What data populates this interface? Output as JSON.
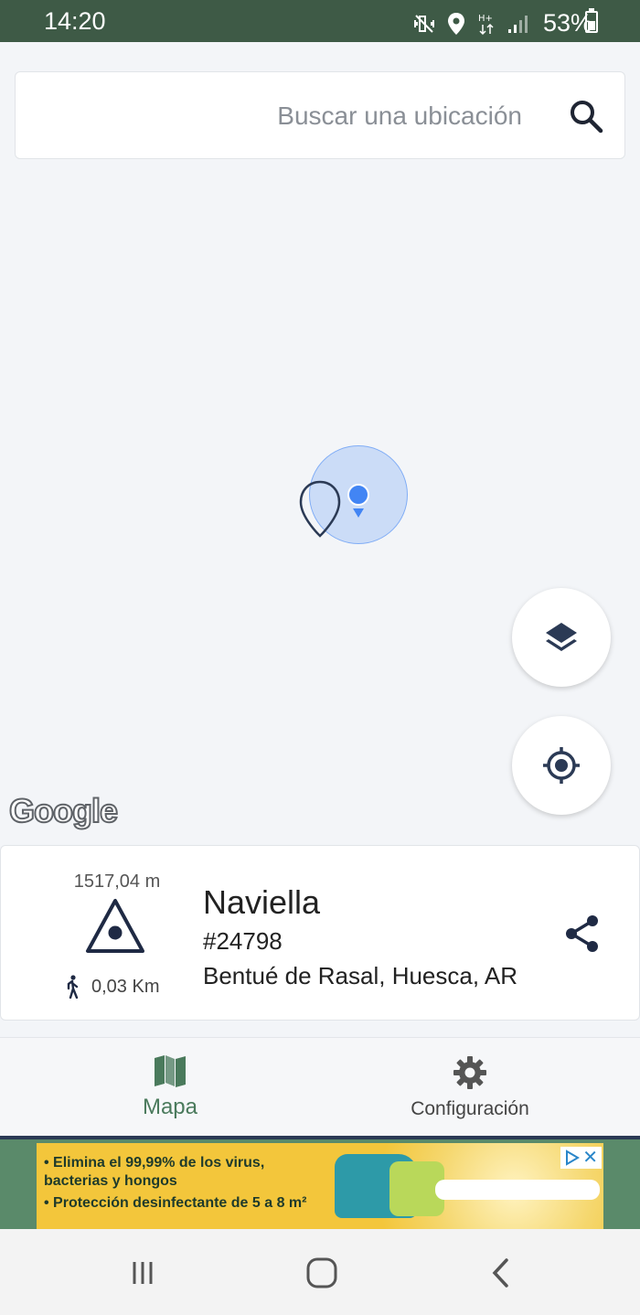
{
  "status_bar": {
    "time": "14:20",
    "battery_percent": "53%",
    "network_label": "H+",
    "icons": [
      "mute-vibrate-icon",
      "location-icon",
      "data-arrows-icon",
      "signal-icon",
      "battery-icon"
    ]
  },
  "search": {
    "placeholder": "Buscar una ubicación"
  },
  "map": {
    "attribution": "Google",
    "marker_color": "#2b3a55",
    "my_location_color": "#4285f4"
  },
  "peak": {
    "elevation": "1517,04 m",
    "name": "Naviella",
    "id": "#24798",
    "location": "Bentué de Rasal, Huesca, AR",
    "distance": "0,03 Km"
  },
  "bottom_nav": {
    "items": [
      {
        "label": "Mapa",
        "icon": "map-icon",
        "active": true
      },
      {
        "label": "Configuración",
        "icon": "gear-icon",
        "active": false
      }
    ],
    "active_color": "#4a7a5c"
  },
  "ad": {
    "line1": "• Elimina el 99,99% de los virus, bacterias y hongos",
    "line2": "• Protección desinfectante de 5 a 8 m²"
  },
  "colors": {
    "status_bar": "#3e5a46",
    "accent": "#2b3a55",
    "ad_background": "#f3c63b"
  }
}
